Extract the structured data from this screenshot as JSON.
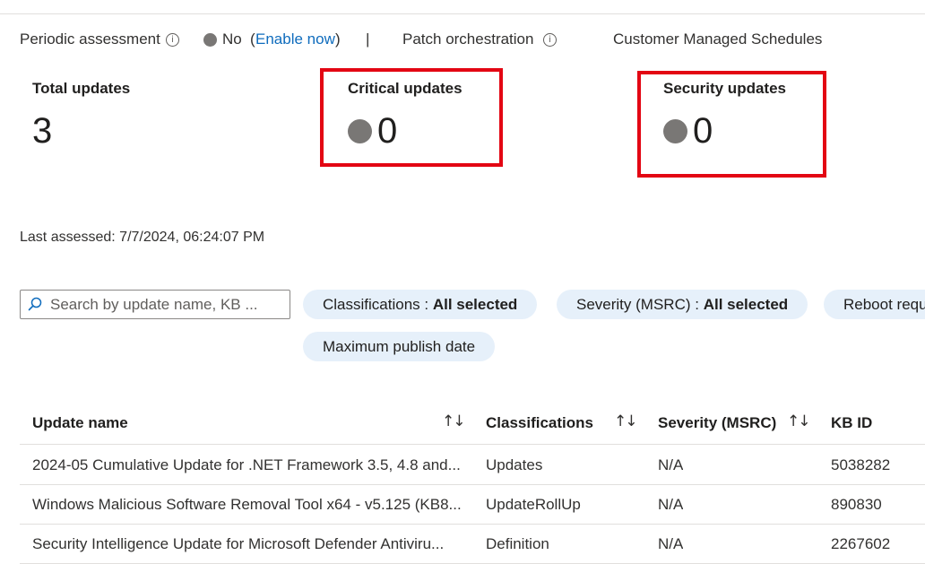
{
  "assessment": {
    "periodic_label": "Periodic assessment",
    "status": "No",
    "open_paren": "(",
    "enable_link": "Enable now",
    "close_paren": ")",
    "separator": "|",
    "patch_label": "Patch orchestration",
    "patch_value": "Customer Managed Schedules"
  },
  "cards": {
    "total": {
      "title": "Total updates",
      "value": "3"
    },
    "critical": {
      "title": "Critical updates",
      "value": "0"
    },
    "security": {
      "title": "Security updates",
      "value": "0"
    }
  },
  "last_assessed": "Last assessed: 7/7/2024, 06:24:07 PM",
  "search": {
    "placeholder": "Search by update name, KB ..."
  },
  "filters": [
    {
      "label": "Classifications : ",
      "value": "All selected"
    },
    {
      "label": "Severity (MSRC) : ",
      "value": "All selected"
    },
    {
      "label": "Reboot requ",
      "value": ""
    },
    {
      "label": "Maximum publish date",
      "value": ""
    }
  ],
  "table": {
    "columns": [
      "Update name",
      "Classifications",
      "Severity (MSRC)",
      "KB ID"
    ],
    "sort_glyph": "↑↓",
    "rows": [
      {
        "name": "2024-05 Cumulative Update for .NET Framework 3.5, 4.8 and...",
        "classification": "Updates",
        "severity": "N/A",
        "kb": "5038282"
      },
      {
        "name": "Windows Malicious Software Removal Tool x64 - v5.125 (KB8...",
        "classification": "UpdateRollUp",
        "severity": "N/A",
        "kb": "890830"
      },
      {
        "name": "Security Intelligence Update for Microsoft Defender Antiviru...",
        "classification": "Definition",
        "severity": "N/A",
        "kb": "2267602"
      }
    ]
  },
  "colors": {
    "highlight": "#e30613",
    "link": "#0f6cbd",
    "pill": "#e6f0fa",
    "dot": "#797775"
  }
}
